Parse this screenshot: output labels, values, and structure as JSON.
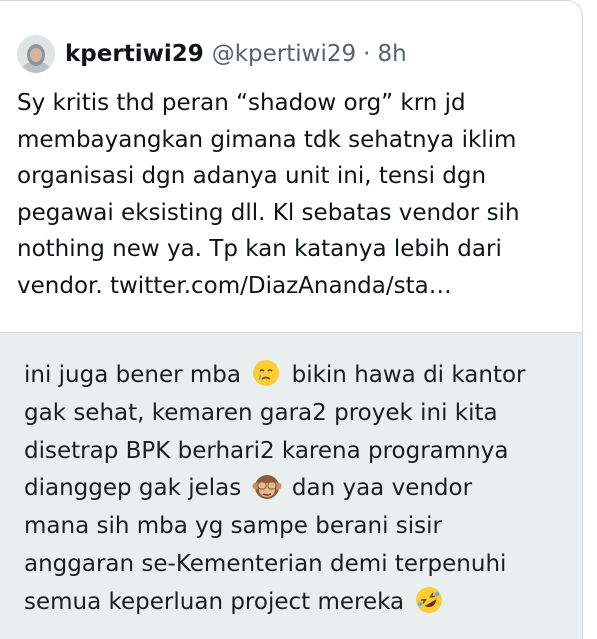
{
  "quoted_tweet": {
    "display_name": "kpertiwi29",
    "handle": "@kpertiwi29",
    "separator": "·",
    "time": "8h",
    "text_lines": [
      "Sy kritis thd peran “shadow org” krn jd",
      "membayangkan gimana tdk sehatnya iklim",
      "organisasi dgn adanya unit ini, tensi dgn",
      "pegawai eksisting dll. Kl sebatas vendor sih",
      "nothing new ya. Tp kan katanya lebih dari",
      "vendor. twitter.com/DiazAnanda/sta…"
    ]
  },
  "reply": {
    "line1_a": "ini juga bener mba",
    "line1_emoji": "crying-face-emoji",
    "line1_b": "bikin hawa di kantor",
    "line2": "gak sehat, kemaren gara2 proyek ini kita",
    "line3": "disetrap BPK berhari2 karena programnya",
    "line4_a": "dianggep gak jelas",
    "line4_emoji": "see-no-evil-monkey-emoji",
    "line4_b": "dan yaa vendor",
    "line5": "mana sih mba yg sampe berani sisir",
    "line6": "anggaran se-Kementerian demi terpenuhi",
    "line7_a": "semua keperluan project mereka",
    "line7_emoji": "rolling-on-floor-laughing-emoji"
  },
  "colors": {
    "text_primary": "#0f1419",
    "text_secondary": "#536471",
    "reply_background": "#e9efee",
    "border": "#cfd9de"
  }
}
